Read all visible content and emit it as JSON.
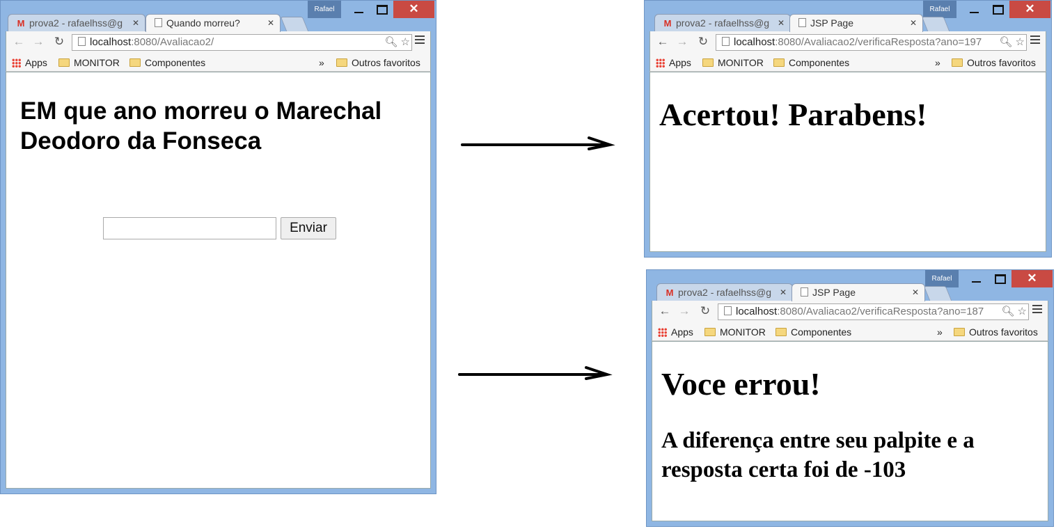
{
  "left_window": {
    "user_badge": "Rafael",
    "tab_inactive_title": "prova2 - rafaelhss@g",
    "tab_active_title": "Quando morreu?",
    "url_host": "localhost",
    "url_path": ":8080/Avaliacao2/",
    "bookmarks": {
      "apps": "Apps",
      "monitor": "MONITOR",
      "componentes": "Componentes",
      "more": "»",
      "outros": "Outros favoritos"
    },
    "heading": "EM que ano morreu o Marechal Deodoro da Fonseca",
    "input_value": "",
    "submit_label": "Enviar"
  },
  "top_right_window": {
    "user_badge": "Rafael",
    "tab_inactive_title": "prova2 - rafaelhss@g",
    "tab_active_title": "JSP Page",
    "url_host": "localhost",
    "url_path": ":8080/Avaliacao2/verificaResposta?ano=197",
    "bookmarks": {
      "apps": "Apps",
      "monitor": "MONITOR",
      "componentes": "Componentes",
      "more": "»",
      "outros": "Outros favoritos"
    },
    "heading": "Acertou! Parabens!"
  },
  "bottom_right_window": {
    "user_badge": "Rafael",
    "tab_inactive_title": "prova2 - rafaelhss@g",
    "tab_active_title": "JSP Page",
    "url_host": "localhost",
    "url_path": ":8080/Avaliacao2/verificaResposta?ano=187",
    "bookmarks": {
      "apps": "Apps",
      "monitor": "MONITOR",
      "componentes": "Componentes",
      "more": "»",
      "outros": "Outros favoritos"
    },
    "heading": "Voce errou!",
    "subheading": "A diferença entre seu palpite e a resposta certa foi de -103"
  },
  "colors": {
    "frame": "#8fb6e3",
    "close": "#c94a43",
    "user_badge": "#5a7fae"
  }
}
